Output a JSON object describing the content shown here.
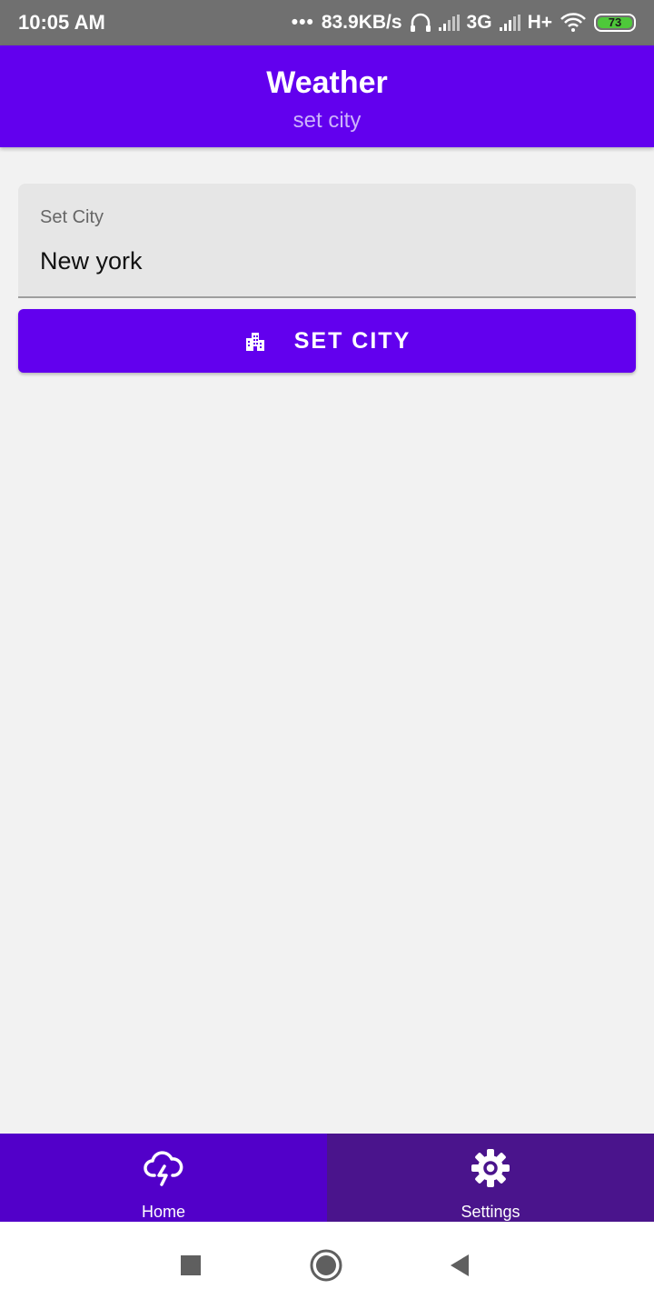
{
  "status_bar": {
    "time": "10:05 AM",
    "network_speed": "83.9KB/s",
    "network_type_1": "3G",
    "network_type_2": "H+",
    "battery_level": "73"
  },
  "app_bar": {
    "title": "Weather",
    "subtitle": "set city"
  },
  "city_field": {
    "label": "Set City",
    "value": "New york"
  },
  "set_city_button": {
    "label": "SET CITY",
    "icon": "city-icon"
  },
  "bottom_nav": {
    "items": [
      {
        "label": "Home",
        "icon": "cloud-lightning-icon"
      },
      {
        "label": "Settings",
        "icon": "gear-icon"
      }
    ]
  },
  "colors": {
    "primary": "#6200ee",
    "bottom_nav_home": "#5200c9",
    "bottom_nav_settings": "#4a148c",
    "status_bar": "#707070"
  }
}
